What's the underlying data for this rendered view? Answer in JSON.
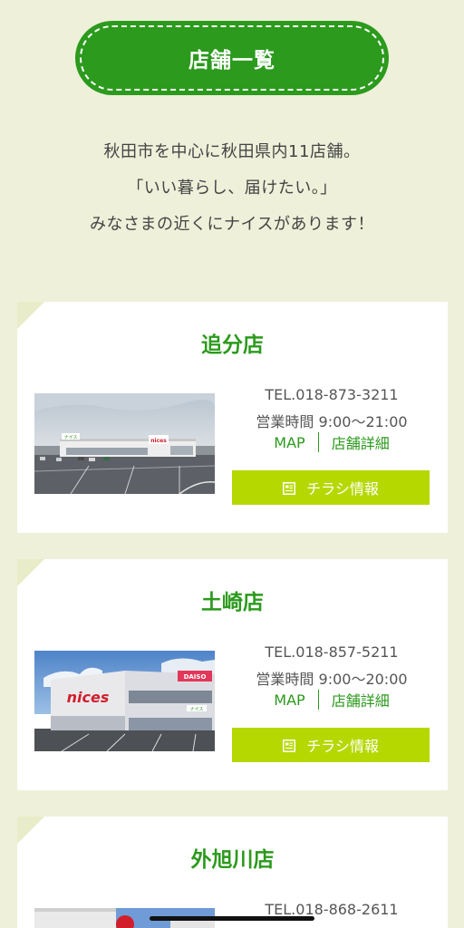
{
  "header": {
    "title": "店舗一覧"
  },
  "intro": {
    "lines": [
      "秋田市を中心に秋田県内11店舗。",
      "「いい暮らし、届けたい。」",
      "みなさまの近くにナイスがあります！"
    ]
  },
  "stores": [
    {
      "name": "追分店",
      "tel": "TEL.018-873-3211",
      "hours": "営業時間 9:00～21:00",
      "map_label": "MAP",
      "detail_label": "店舗詳細",
      "flyer_label": "チラシ情報",
      "photo_sign": "ナイス",
      "photo_logo": "nices"
    },
    {
      "name": "土崎店",
      "tel": "TEL.018-857-5211",
      "hours": "営業時間 9:00～20:00",
      "map_label": "MAP",
      "detail_label": "店舗詳細",
      "flyer_label": "チラシ情報",
      "photo_sign": "ナイス",
      "photo_logo": "nices",
      "photo_banner": "DAISO"
    },
    {
      "name": "外旭川店",
      "tel": "TEL.018-868-2611"
    }
  ],
  "colors": {
    "background": "#eef0d9",
    "brand_green": "#2c9a1d",
    "flyer_button": "#b5d800",
    "card": "#ffffff"
  },
  "icons": {
    "flyer": "flyer-document-icon"
  }
}
